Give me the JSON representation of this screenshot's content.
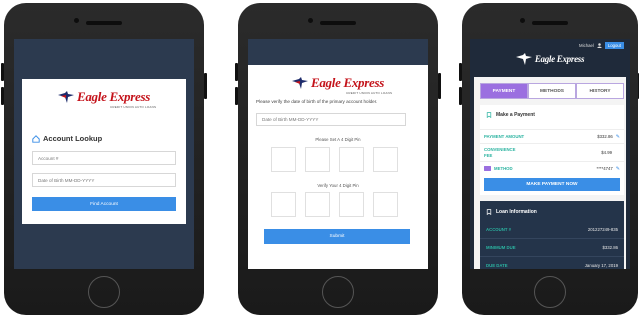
{
  "brand": {
    "name": "Eagle Express",
    "tagline": "CREDIT UNION AUTO LOANS"
  },
  "colors": {
    "accent": "#3a8ee6",
    "brand_red": "#c4121a",
    "teal": "#2bb3a0",
    "purple": "#9b6fe0",
    "dark_navy": "#2c3a4f"
  },
  "screen1": {
    "title": "Account Lookup",
    "account_placeholder": "Account #",
    "dob_placeholder": "Date of Birth MM-DD-YYYY",
    "button": "Find Account"
  },
  "screen2": {
    "instructions": "Please verify the date of birth of the primary account holder.",
    "dob_placeholder": "Date of Birth MM-DD-YYYY",
    "pin_set_label": "Please Set A 4 Digit Pin",
    "pin_verify_label": "Verify Your 4 Digit Pin",
    "button": "Submit"
  },
  "screen3": {
    "user": "Michael",
    "logout": "Logout",
    "tabs": [
      "PAYMENT",
      "METHODS",
      "HISTORY"
    ],
    "active_tab": "PAYMENT",
    "make_payment": {
      "title": "Make a Payment",
      "rows": [
        {
          "label": "PAYMENT AMOUNT",
          "value": "$332.86"
        },
        {
          "label": "CONVENIENCE FEE",
          "value": "$4.99"
        },
        {
          "label": "METHOD",
          "value": "****4747"
        }
      ],
      "button": "MAKE PAYMENT NOW"
    },
    "loan_info": {
      "title": "Loan Information",
      "rows": [
        {
          "label": "ACCOUNT #",
          "value": "201227249-835"
        },
        {
          "label": "MINIMUM DUE",
          "value": "$332.86"
        },
        {
          "label": "DUE DATE",
          "value": "January 17, 2019"
        }
      ]
    }
  }
}
